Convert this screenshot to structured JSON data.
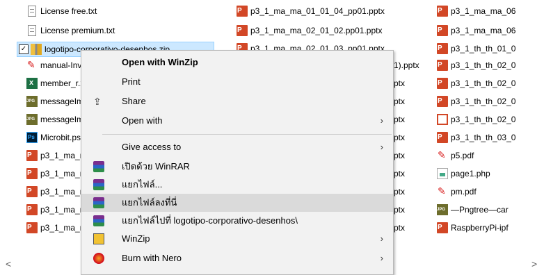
{
  "files": {
    "col1": [
      {
        "name": "License free.txt",
        "icon": "text-file-icon"
      },
      {
        "name": "License premium.txt",
        "icon": "text-file-icon"
      },
      {
        "name": "logotipo-corporativo-desenhos.zip",
        "icon": "zip-file-icon",
        "selected": true
      },
      {
        "name": "manual-Inv",
        "icon": "pdf-file-icon"
      },
      {
        "name": "member_r.x",
        "icon": "excel-file-icon"
      },
      {
        "name": "messageIm",
        "icon": "jpg-file-icon"
      },
      {
        "name": "messageIm",
        "icon": "jpg-file-icon"
      },
      {
        "name": "Microbit.ps",
        "icon": "photoshop-file-icon"
      },
      {
        "name": "p3_1_ma_m",
        "icon": "pptx-file-icon"
      },
      {
        "name": "p3_1_ma_m",
        "icon": "pptx-file-icon"
      },
      {
        "name": "p3_1_ma_m",
        "icon": "pptx-file-icon"
      },
      {
        "name": "p3_1_ma_m",
        "icon": "pptx-file-icon"
      },
      {
        "name": "p3_1_ma_m",
        "icon": "pptx-file-icon"
      }
    ],
    "col2": [
      {
        "name": "p3_1_ma_ma_01_01_04_pp01.pptx",
        "icon": "pptx-file-icon"
      },
      {
        "name": "p3_1_ma_ma_02_01_02.pp01.pptx",
        "icon": "pptx-file-icon"
      },
      {
        "name": "p3_1_ma_ma_02_01_03_pp01.pptx",
        "icon": "pptx-file-icon"
      },
      {
        "name": "1).pptx",
        "icon": "pptx-file-icon"
      },
      {
        "name": "ptx",
        "icon": "pptx-file-icon"
      },
      {
        "name": "ptx",
        "icon": "pptx-file-icon"
      },
      {
        "name": "ptx",
        "icon": "pptx-file-icon"
      },
      {
        "name": "ptx",
        "icon": "pptx-file-icon"
      },
      {
        "name": "ptx",
        "icon": "pptx-file-icon"
      },
      {
        "name": "ptx",
        "icon": "pptx-file-icon"
      },
      {
        "name": "ptx",
        "icon": "pptx-file-icon"
      },
      {
        "name": "ptx",
        "icon": "pptx-file-icon"
      },
      {
        "name": "ptx",
        "icon": "pptx-file-icon"
      }
    ],
    "col3": [
      {
        "name": "p3_1_ma_ma_06",
        "icon": "pptx-file-icon"
      },
      {
        "name": "p3_1_ma_ma_06",
        "icon": "pptx-file-icon"
      },
      {
        "name": "p3_1_th_th_01_0",
        "icon": "pptx-file-icon"
      },
      {
        "name": "p3_1_th_th_02_0",
        "icon": "pptx-file-icon"
      },
      {
        "name": "p3_1_th_th_02_0",
        "icon": "pptx-file-icon"
      },
      {
        "name": "p3_1_th_th_02_0",
        "icon": "pptx-file-icon"
      },
      {
        "name": "p3_1_th_th_02_0",
        "icon": "pptx-show-icon"
      },
      {
        "name": "p3_1_th_th_03_0",
        "icon": "pptx-file-icon"
      },
      {
        "name": "p5.pdf",
        "icon": "pdf-file-icon"
      },
      {
        "name": "page1.php",
        "icon": "php-file-icon"
      },
      {
        "name": "pm.pdf",
        "icon": "pdf-file-icon"
      },
      {
        "name": "—Pngtree—car",
        "icon": "jpg-file-icon"
      },
      {
        "name": "RaspberryPi-ipf",
        "icon": "pptx-file-icon"
      }
    ]
  },
  "context_menu": {
    "items": [
      {
        "label": "Open with WinZip",
        "bold": true,
        "icon": "",
        "submenu": false
      },
      {
        "label": "Print",
        "icon": "",
        "submenu": false
      },
      {
        "label": "Share",
        "icon": "share-icon",
        "submenu": false
      },
      {
        "label": "Open with",
        "icon": "",
        "submenu": true
      },
      {
        "label": "Give access to",
        "icon": "",
        "submenu": true
      },
      {
        "label": "เปิดด้วย WinRAR",
        "icon": "winrar-icon",
        "submenu": false
      },
      {
        "label": "แยกไฟล์...",
        "icon": "winrar-icon",
        "submenu": false
      },
      {
        "label": "แยกไฟล์ลงที่นี่",
        "icon": "winrar-icon",
        "submenu": false,
        "highlighted": true
      },
      {
        "label": "แยกไฟล์ไปที่ logotipo-corporativo-desenhos\\",
        "icon": "winrar-icon",
        "submenu": false
      },
      {
        "label": "WinZip",
        "icon": "winzip-icon",
        "submenu": true
      },
      {
        "label": "Burn with Nero",
        "icon": "nero-icon",
        "submenu": true
      }
    ]
  },
  "scrollbar": {
    "left": "<",
    "right": ">"
  }
}
